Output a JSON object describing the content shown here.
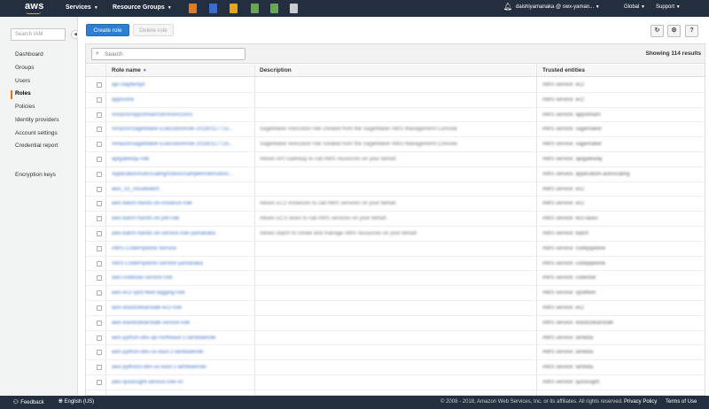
{
  "topnav": {
    "logo": "aws",
    "services": "Services",
    "resource_groups": "Resource Groups",
    "service_icons": [
      {
        "name": "ec2-icon",
        "color": "#e07b24"
      },
      {
        "name": "dynamodb-icon",
        "color": "#3b6ccf"
      },
      {
        "name": "lambda-icon",
        "color": "#e8a316"
      },
      {
        "name": "codestar-icon",
        "color": "#6aa84f"
      },
      {
        "name": "elasticbeanstalk-icon",
        "color": "#6aa84f"
      },
      {
        "name": "pin-icon",
        "color": "#cccccc"
      }
    ],
    "account": "daishiyamanaka @ swx-yaman...",
    "region": "Global",
    "support": "Support"
  },
  "sidebar": {
    "search_placeholder": "Search IAM",
    "items": [
      {
        "label": "Dashboard"
      },
      {
        "label": "Groups"
      },
      {
        "label": "Users"
      },
      {
        "label": "Roles"
      },
      {
        "label": "Policies"
      },
      {
        "label": "Identity providers"
      },
      {
        "label": "Account settings"
      },
      {
        "label": "Credential report"
      },
      {
        "label": "Encryption keys"
      }
    ],
    "active": "Roles"
  },
  "toolbar": {
    "create_role": "Create role",
    "delete_role": "Delete role"
  },
  "filter": {
    "placeholder": "Search",
    "showing": "Showing 114 results"
  },
  "table": {
    "columns": [
      "Role name",
      "Description",
      "Trusted entities"
    ],
    "rows": [
      {
        "name": "api-claybertyd",
        "desc": "",
        "trust": "AWS service: ec2"
      },
      {
        "name": "apprunne",
        "desc": "",
        "trust": "AWS service: ec2"
      },
      {
        "name": "AmazonAppStreamServiceAccess",
        "desc": "",
        "trust": "AWS service: appstream"
      },
      {
        "name": "AmazonSageMaker-ExecutionRole-20180117T15...",
        "desc": "SageMaker execution role created from the SageMaker AWS Management Console.",
        "trust": "AWS service: sagemaker"
      },
      {
        "name": "AmazonSageMaker-ExecutionRole-20180117T16...",
        "desc": "SageMaker execution role created from the SageMaker AWS Management Console.",
        "trust": "AWS service: sagemaker"
      },
      {
        "name": "apigateway-role",
        "desc": "Allows API Gateway to call AWS resources on your behalf.",
        "trust": "AWS service: apigateway"
      },
      {
        "name": "ApplicationAutoScalingActionsSampleRoleAutosc...",
        "desc": "",
        "trust": "AWS service: application-autoscaling"
      },
      {
        "name": "aws_s3_cloudwatch",
        "desc": "",
        "trust": "AWS service: ec2"
      },
      {
        "name": "aws-batch-hands-on-instance-role",
        "desc": "Allows EC2 instances to call AWS services on your behalf.",
        "trust": "AWS service: ec2"
      },
      {
        "name": "aws-batch-hands-on-job-role",
        "desc": "Allows ECS tasks to call AWS services on your behalf.",
        "trust": "AWS service: ecs-tasks"
      },
      {
        "name": "aws-batch-hands-on-service-role-yamanaka",
        "desc": "Allows Batch to create and manage AWS resources on your behalf.",
        "trust": "AWS service: batch"
      },
      {
        "name": "AWS-CodePipeline-Service",
        "desc": "",
        "trust": "AWS service: codepipeline"
      },
      {
        "name": "AWS-CodePipeline-Service-yamanaka",
        "desc": "",
        "trust": "AWS service: codepipeline"
      },
      {
        "name": "aws-codestar-service-role",
        "desc": "",
        "trust": "AWS service: codestar"
      },
      {
        "name": "aws-ec2-spot-fleet-tagging-role",
        "desc": "",
        "trust": "AWS service: spotfleet"
      },
      {
        "name": "aws-elasticbeanstalk-ec2-role",
        "desc": "",
        "trust": "AWS service: ec2"
      },
      {
        "name": "aws-elasticbeanstalk-service-role",
        "desc": "",
        "trust": "AWS service: elasticbeanstalk"
      },
      {
        "name": "aws-python-dev-ap-northeast-1-lambdaRole",
        "desc": "",
        "trust": "AWS service: lambda"
      },
      {
        "name": "aws-python-dev-us-east-2-lambdaRole",
        "desc": "",
        "trust": "AWS service: lambda"
      },
      {
        "name": "aws-python3-dev-us-east-1-lambdaRole",
        "desc": "",
        "trust": "AWS service: lambda"
      },
      {
        "name": "aws-quicksight-service-role-v0",
        "desc": "",
        "trust": "AWS service: quicksight"
      }
    ]
  },
  "footer": {
    "feedback": "Feedback",
    "language": "English (US)",
    "copyright": "© 2008 - 2018, Amazon Web Services, Inc. or its affiliates. All rights reserved.",
    "privacy": "Privacy Policy",
    "terms": "Terms of Use"
  }
}
